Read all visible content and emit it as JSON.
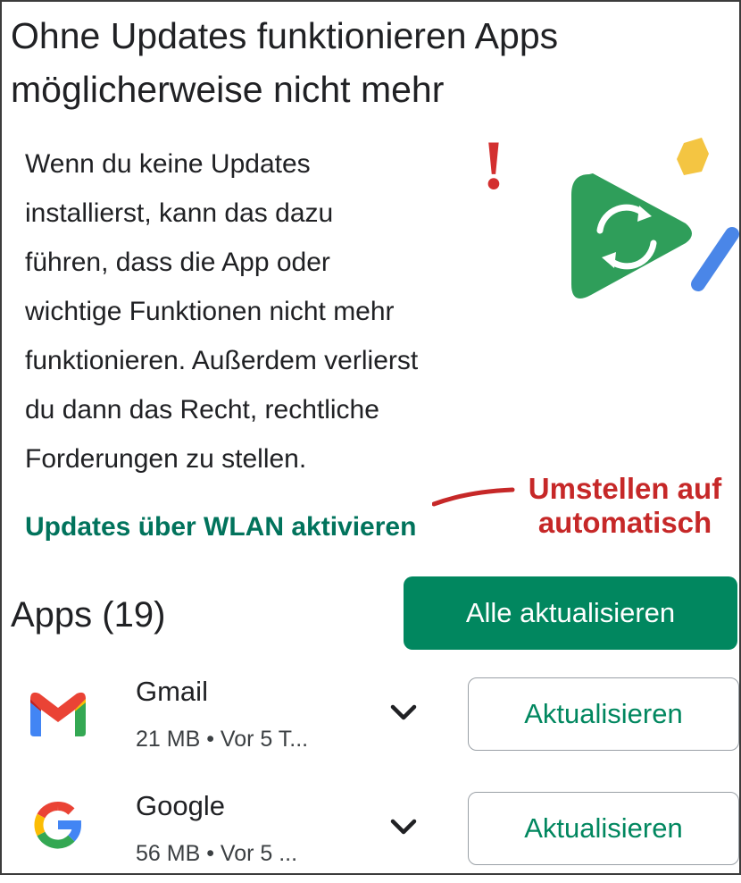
{
  "header": {
    "title_line1": "Ohne Updates funktionieren Apps",
    "title_line2": "möglicherweise nicht mehr"
  },
  "notice": {
    "lines": [
      "Wenn du keine Updates",
      "installierst, kann das dazu",
      "führen, dass die App oder",
      "wichtige Funktionen nicht mehr",
      "funktionieren. Außerdem verlierst",
      "du dann das Recht, rechtliche",
      "Forderungen zu stellen."
    ],
    "wlan_link": "Updates über WLAN aktivieren"
  },
  "annotation": {
    "exclamation": "!",
    "line1": "Umstellen auf",
    "line2": "automatisch",
    "color": "#c62828"
  },
  "apps_section": {
    "title": "Apps (19)",
    "update_all_label": "Alle aktualisieren"
  },
  "apps": [
    {
      "name": "Gmail",
      "meta": "21 MB  •  Vor 5 T...",
      "icon": "gmail-icon",
      "button": "Aktualisieren"
    },
    {
      "name": "Google",
      "meta": "56 MB  •  Vor 5 ...",
      "icon": "google-icon",
      "button": "Aktualisieren"
    }
  ],
  "colors": {
    "accent": "#01875f",
    "link": "#01735c",
    "annotation": "#c62828"
  }
}
